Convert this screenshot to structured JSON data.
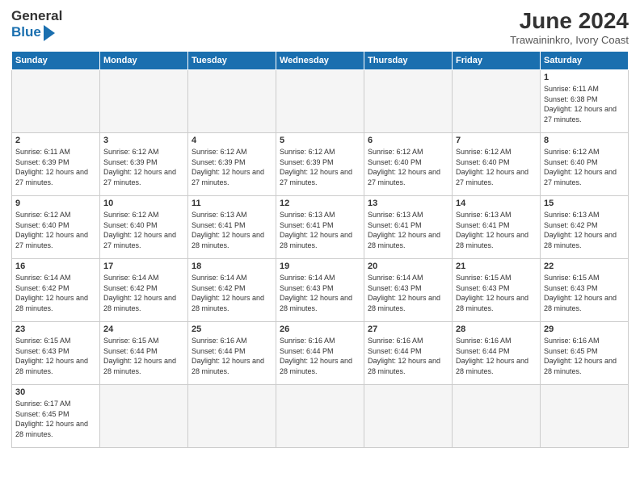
{
  "header": {
    "logo_general": "General",
    "logo_blue": "Blue",
    "month_title": "June 2024",
    "location": "Trawaininkro, Ivory Coast"
  },
  "weekdays": [
    "Sunday",
    "Monday",
    "Tuesday",
    "Wednesday",
    "Thursday",
    "Friday",
    "Saturday"
  ],
  "weeks": [
    [
      {
        "day": "",
        "empty": true
      },
      {
        "day": "",
        "empty": true
      },
      {
        "day": "",
        "empty": true
      },
      {
        "day": "",
        "empty": true
      },
      {
        "day": "",
        "empty": true
      },
      {
        "day": "",
        "empty": true
      },
      {
        "day": "1",
        "sunrise": "6:11 AM",
        "sunset": "6:38 PM",
        "daylight": "12 hours and 27 minutes."
      }
    ],
    [
      {
        "day": "2",
        "sunrise": "6:11 AM",
        "sunset": "6:39 PM",
        "daylight": "12 hours and 27 minutes."
      },
      {
        "day": "3",
        "sunrise": "6:12 AM",
        "sunset": "6:39 PM",
        "daylight": "12 hours and 27 minutes."
      },
      {
        "day": "4",
        "sunrise": "6:12 AM",
        "sunset": "6:39 PM",
        "daylight": "12 hours and 27 minutes."
      },
      {
        "day": "5",
        "sunrise": "6:12 AM",
        "sunset": "6:39 PM",
        "daylight": "12 hours and 27 minutes."
      },
      {
        "day": "6",
        "sunrise": "6:12 AM",
        "sunset": "6:40 PM",
        "daylight": "12 hours and 27 minutes."
      },
      {
        "day": "7",
        "sunrise": "6:12 AM",
        "sunset": "6:40 PM",
        "daylight": "12 hours and 27 minutes."
      },
      {
        "day": "8",
        "sunrise": "6:12 AM",
        "sunset": "6:40 PM",
        "daylight": "12 hours and 27 minutes."
      }
    ],
    [
      {
        "day": "9",
        "sunrise": "6:12 AM",
        "sunset": "6:40 PM",
        "daylight": "12 hours and 27 minutes."
      },
      {
        "day": "10",
        "sunrise": "6:12 AM",
        "sunset": "6:40 PM",
        "daylight": "12 hours and 27 minutes."
      },
      {
        "day": "11",
        "sunrise": "6:13 AM",
        "sunset": "6:41 PM",
        "daylight": "12 hours and 28 minutes."
      },
      {
        "day": "12",
        "sunrise": "6:13 AM",
        "sunset": "6:41 PM",
        "daylight": "12 hours and 28 minutes."
      },
      {
        "day": "13",
        "sunrise": "6:13 AM",
        "sunset": "6:41 PM",
        "daylight": "12 hours and 28 minutes."
      },
      {
        "day": "14",
        "sunrise": "6:13 AM",
        "sunset": "6:41 PM",
        "daylight": "12 hours and 28 minutes."
      },
      {
        "day": "15",
        "sunrise": "6:13 AM",
        "sunset": "6:42 PM",
        "daylight": "12 hours and 28 minutes."
      }
    ],
    [
      {
        "day": "16",
        "sunrise": "6:14 AM",
        "sunset": "6:42 PM",
        "daylight": "12 hours and 28 minutes."
      },
      {
        "day": "17",
        "sunrise": "6:14 AM",
        "sunset": "6:42 PM",
        "daylight": "12 hours and 28 minutes."
      },
      {
        "day": "18",
        "sunrise": "6:14 AM",
        "sunset": "6:42 PM",
        "daylight": "12 hours and 28 minutes."
      },
      {
        "day": "19",
        "sunrise": "6:14 AM",
        "sunset": "6:43 PM",
        "daylight": "12 hours and 28 minutes."
      },
      {
        "day": "20",
        "sunrise": "6:14 AM",
        "sunset": "6:43 PM",
        "daylight": "12 hours and 28 minutes."
      },
      {
        "day": "21",
        "sunrise": "6:15 AM",
        "sunset": "6:43 PM",
        "daylight": "12 hours and 28 minutes."
      },
      {
        "day": "22",
        "sunrise": "6:15 AM",
        "sunset": "6:43 PM",
        "daylight": "12 hours and 28 minutes."
      }
    ],
    [
      {
        "day": "23",
        "sunrise": "6:15 AM",
        "sunset": "6:43 PM",
        "daylight": "12 hours and 28 minutes."
      },
      {
        "day": "24",
        "sunrise": "6:15 AM",
        "sunset": "6:44 PM",
        "daylight": "12 hours and 28 minutes."
      },
      {
        "day": "25",
        "sunrise": "6:16 AM",
        "sunset": "6:44 PM",
        "daylight": "12 hours and 28 minutes."
      },
      {
        "day": "26",
        "sunrise": "6:16 AM",
        "sunset": "6:44 PM",
        "daylight": "12 hours and 28 minutes."
      },
      {
        "day": "27",
        "sunrise": "6:16 AM",
        "sunset": "6:44 PM",
        "daylight": "12 hours and 28 minutes."
      },
      {
        "day": "28",
        "sunrise": "6:16 AM",
        "sunset": "6:44 PM",
        "daylight": "12 hours and 28 minutes."
      },
      {
        "day": "29",
        "sunrise": "6:16 AM",
        "sunset": "6:45 PM",
        "daylight": "12 hours and 28 minutes."
      }
    ],
    [
      {
        "day": "30",
        "sunrise": "6:17 AM",
        "sunset": "6:45 PM",
        "daylight": "12 hours and 28 minutes."
      },
      {
        "day": "",
        "empty": true
      },
      {
        "day": "",
        "empty": true
      },
      {
        "day": "",
        "empty": true
      },
      {
        "day": "",
        "empty": true
      },
      {
        "day": "",
        "empty": true
      },
      {
        "day": "",
        "empty": true
      }
    ]
  ]
}
